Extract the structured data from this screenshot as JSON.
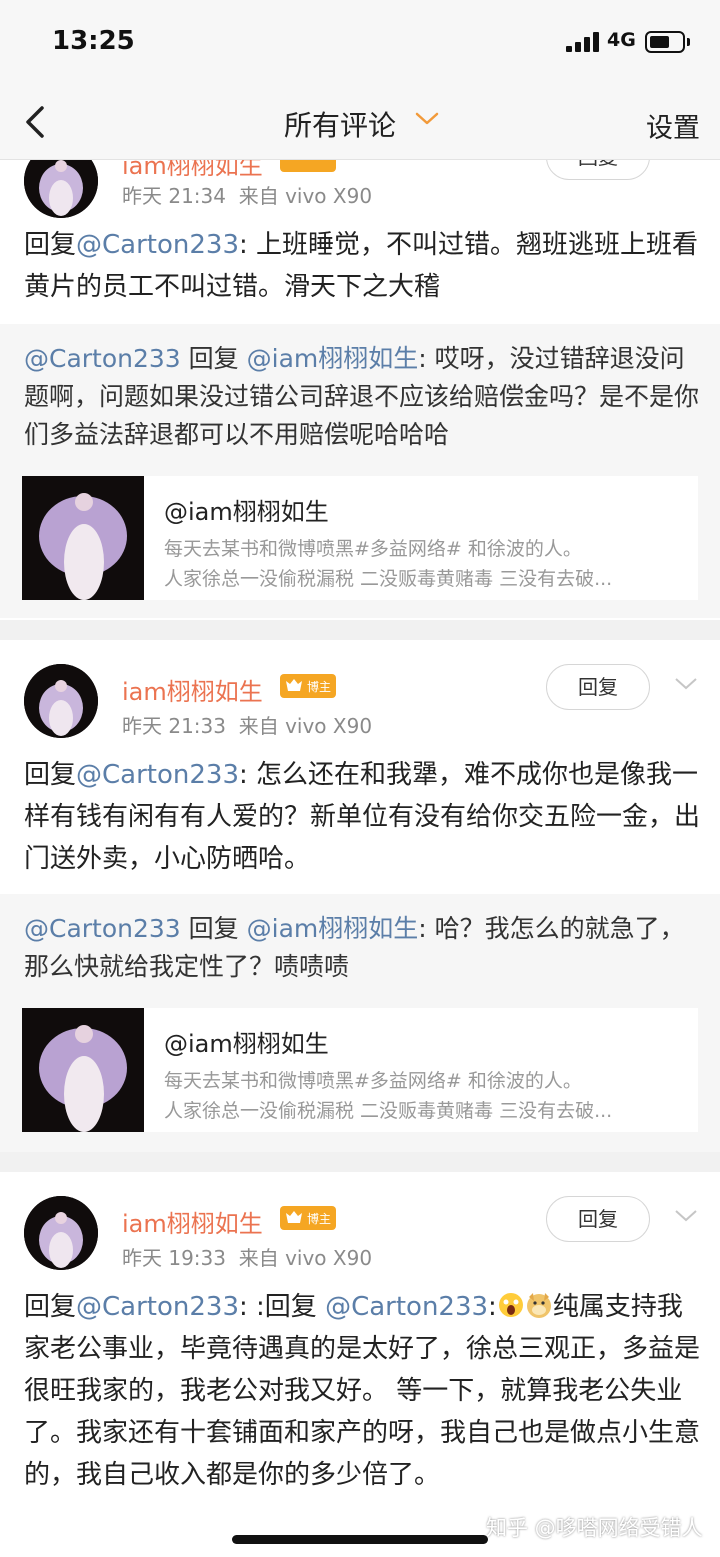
{
  "status": {
    "time": "13:25",
    "network": "4G",
    "battery_level": 0.6
  },
  "nav": {
    "title": "所有评论",
    "settings": "设置"
  },
  "comments": [
    {
      "username": "iam栩栩如生",
      "badge": "博主",
      "time": "昨天 21:34",
      "device": "来自 vivo X90",
      "reply_label": "回复",
      "prefix": "回复",
      "mention": "@Carton233",
      "text": ": 上班睡觉，不叫过错。翘班逃班上班看黄片的员工不叫过错。滑天下之大稽",
      "quote": {
        "from": "@Carton233",
        "mid": "回复",
        "to": "@iam栩栩如生",
        "text": ": 哎呀，没过错辞退没问题啊，问题如果没过错公司辞退不应该给赔偿金吗？是不是你们多益法辞退都可以不用赔偿呢哈哈哈"
      },
      "card": {
        "title": "@iam栩栩如生",
        "line1": "每天去某书和微博喷黑#多益网络# 和徐波的人。",
        "line2": "人家徐总一没偷税漏税 二没贩毒黄赌毒 三没有去破..."
      }
    },
    {
      "username": "iam栩栩如生",
      "badge": "博主",
      "time": "昨天 21:33",
      "device": "来自 vivo X90",
      "reply_label": "回复",
      "prefix": "回复",
      "mention": "@Carton233",
      "text": ": 怎么还在和我犟，难不成你也是像我一样有钱有闲有有人爱的？新单位有没有给你交五险一金，出门送外卖，小心防晒哈。",
      "quote": {
        "from": "@Carton233",
        "mid": "回复",
        "to": "@iam栩栩如生",
        "text": ": 哈？我怎么的就急了，那么快就给我定性了？啧啧啧"
      },
      "card": {
        "title": "@iam栩栩如生",
        "line1": "每天去某书和微博喷黑#多益网络# 和徐波的人。",
        "line2": "人家徐总一没偷税漏税 二没贩毒黄赌毒 三没有去破..."
      }
    },
    {
      "username": "iam栩栩如生",
      "badge": "博主",
      "time": "昨天 19:33",
      "device": "来自 vivo X90",
      "reply_label": "回复",
      "prefix": "回复",
      "mention": "@Carton233",
      "mid": ": :回复",
      "mention2": "@Carton233",
      "colon": ":",
      "text": "纯属支持我家老公事业，毕竟待遇真的是太好了，徐总三观正，多益是很旺我家的，我老公对我又好。 等一下，就算我老公失业了。我家还有十套铺面和家产的呀，我自己也是做点小生意的，我自己收入都是你的多少倍了。"
    }
  ],
  "watermark": "知乎 @哆嗒网络受错人"
}
